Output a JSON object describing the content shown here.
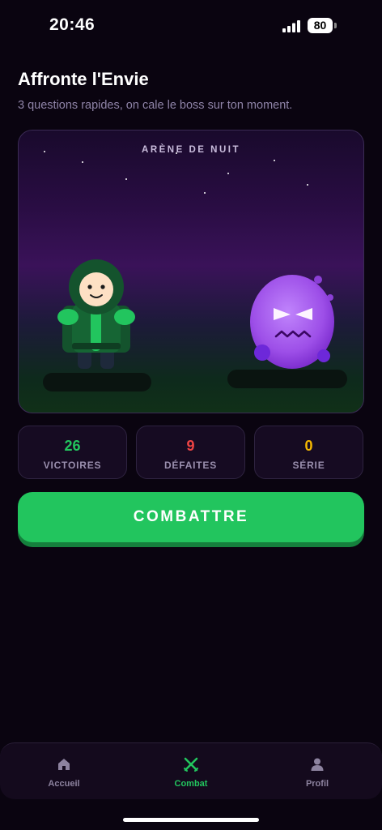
{
  "status_bar": {
    "time": "20:46",
    "battery": "80"
  },
  "header": {
    "title": "Affronte l'Envie",
    "subtitle": "3 questions rapides, on cale le boss sur ton moment."
  },
  "arena": {
    "title": "ARÈNE DE NUIT",
    "hero_icon": "hooded-hero-icon",
    "boss_icon": "angry-purple-blob-icon"
  },
  "stats": [
    {
      "value": "26",
      "label": "VICTOIRES",
      "color": "#22c55e"
    },
    {
      "value": "9",
      "label": "DÉFAITES",
      "color": "#ef4444"
    },
    {
      "value": "0",
      "label": "SÉRIE",
      "color": "#f5b800"
    }
  ],
  "fight_button": {
    "label": "COMBATTRE",
    "color": "#22c55e"
  },
  "nav": {
    "items": [
      {
        "label": "Accueil",
        "icon": "home-icon",
        "active": false
      },
      {
        "label": "Combat",
        "icon": "crossed-swords-icon",
        "active": true
      },
      {
        "label": "Profil",
        "icon": "user-icon",
        "active": false
      }
    ]
  },
  "colors": {
    "background": "#0a0410",
    "accent": "#22c55e",
    "muted_text": "#8f84a8"
  }
}
